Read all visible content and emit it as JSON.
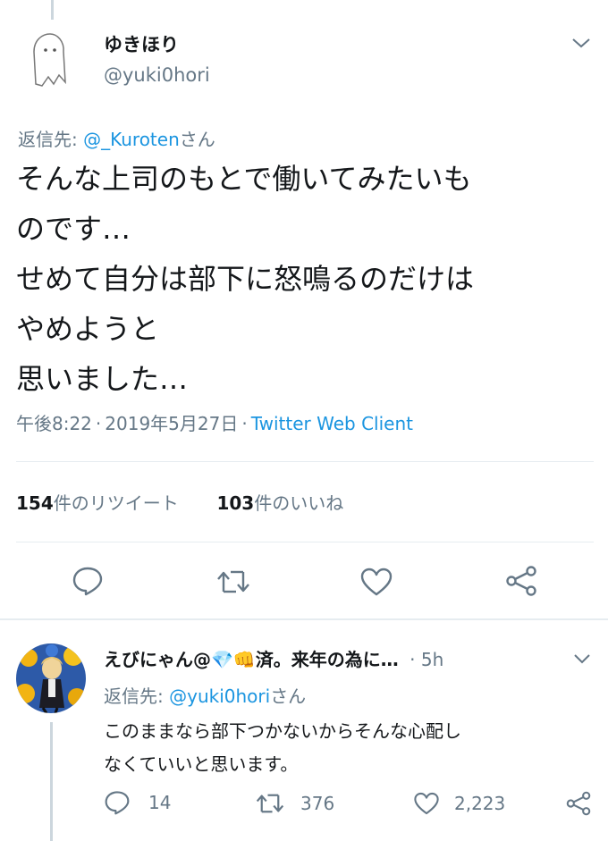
{
  "main_tweet": {
    "author": {
      "display_name": "ゆきほり",
      "handle": "@yuki0hori"
    },
    "reply_to": {
      "prefix": "返信先: ",
      "handle": "@_Kuroten",
      "suffix": "さん"
    },
    "text_lines": [
      "そんな上司のもとで働いてみたいも",
      "のです…",
      "せめて自分は部下に怒鳴るのだけは",
      "やめようと",
      "思いました…"
    ],
    "meta": {
      "time": "午後8:22",
      "date": "2019年5月27日",
      "separator": "·",
      "client": "Twitter Web Client"
    },
    "stats": {
      "retweets": {
        "count": "154",
        "label": "件のリツイート"
      },
      "likes": {
        "count": "103",
        "label": "件のいいね"
      }
    },
    "actions": [
      "reply-icon",
      "retweet-icon",
      "like-icon",
      "share-icon"
    ]
  },
  "reply_tweet": {
    "author": {
      "name_prefix": "えびにゃん@",
      "gem_emoji": "💎",
      "fist_emoji": "👊",
      "name_suffix": "済。来年の為に…",
      "dot": "·",
      "time": "5h"
    },
    "reply_to": {
      "prefix": "返信先: ",
      "handle": "@yuki0hori",
      "suffix": "さん"
    },
    "text_lines": [
      "このままなら部下つかないからそんな心配し",
      "なくていいと思います。"
    ],
    "actions": {
      "replies": "14",
      "retweets": "376",
      "likes": "2,223"
    }
  },
  "colors": {
    "link": "#1b95e0",
    "muted": "#657786",
    "text": "#14171a",
    "divider": "#e6ecf0",
    "icon": "#657786"
  }
}
